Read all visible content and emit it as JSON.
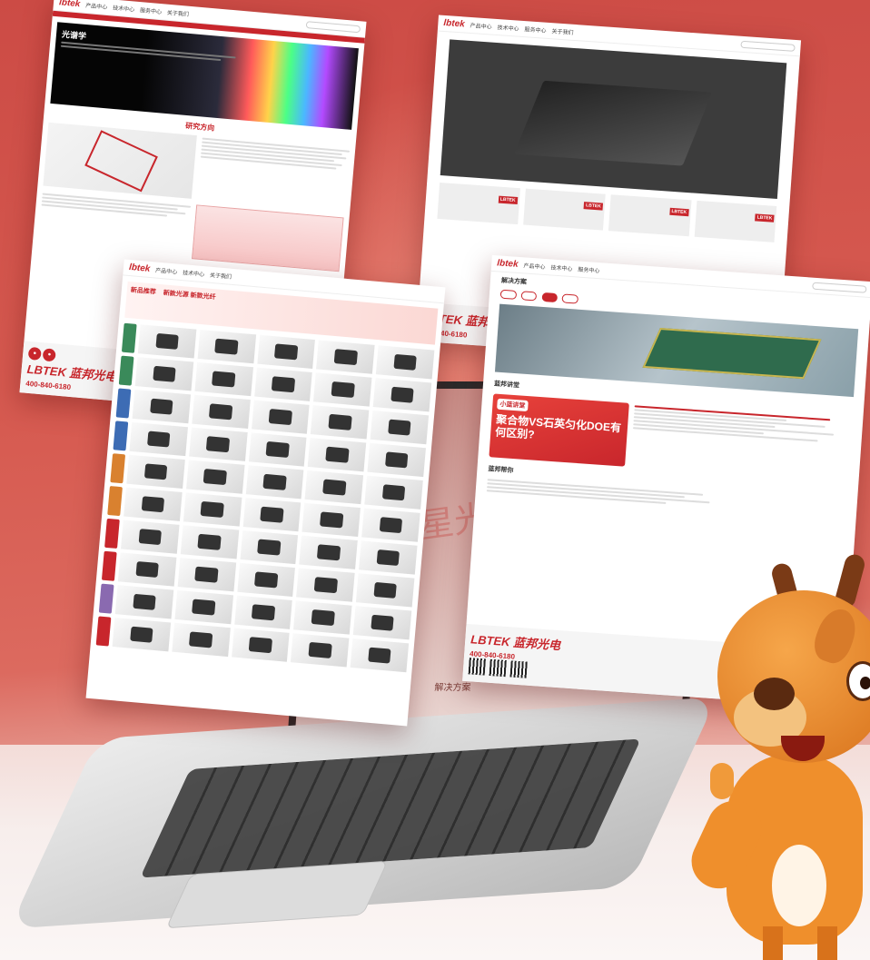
{
  "colors": {
    "brand": "#c8262c",
    "background": "#d65a50"
  },
  "laptop": {
    "ghost_text": "星光计划",
    "section_title": "解决方案"
  },
  "sheet1": {
    "logo": "lbtek",
    "nav": [
      "产品中心",
      "技术中心",
      "服务中心",
      "关于我们"
    ],
    "hero_title": "光谱学",
    "section": "研究方向",
    "footer_logo": "LBTEK 蓝邦光电",
    "footer_phone": "400-840-6180"
  },
  "sheet2": {
    "logo": "lbtek",
    "nav": [
      "产品中心",
      "技术中心",
      "服务中心",
      "关于我们"
    ],
    "thumb_badge": "LBTEK",
    "footer_logo": "LBTEK 蓝邦光电",
    "footer_phone": "400-840-6180"
  },
  "sheet3": {
    "logo": "lbtek",
    "nav": [
      "产品中心",
      "技术中心",
      "关于我们"
    ],
    "promo_left": "新品推荐",
    "promo_right": "新款光源 新款光纤"
  },
  "sheet4": {
    "logo": "lbtek",
    "nav": [
      "产品中心",
      "技术中心",
      "服务中心"
    ],
    "section_solutions": "解决方案",
    "section_lessons": "蓝邦讲堂",
    "section_help": "蓝邦帮你",
    "lesson_tag": "小蓝讲堂",
    "lesson_headline": "聚合物VS石英匀化DOE有何区别?",
    "footer_logo": "LBTEK 蓝邦光电",
    "footer_phone": "400-840-6180"
  }
}
